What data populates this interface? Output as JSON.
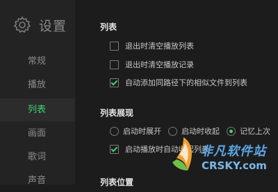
{
  "sidebar": {
    "title": "设置",
    "title_icon": "gear-icon",
    "items": [
      {
        "label": "常规"
      },
      {
        "label": "播放"
      },
      {
        "label": "列表"
      },
      {
        "label": "画面"
      },
      {
        "label": "歌词"
      },
      {
        "label": "声音"
      }
    ],
    "active_index": 2
  },
  "sections": {
    "list": {
      "title": "列表",
      "options": [
        {
          "label": "退出时清空播放列表",
          "checked": false
        },
        {
          "label": "退出时清空播放记录",
          "checked": false
        },
        {
          "label": "自动添加同路径下的相似文件到列表",
          "checked": true
        }
      ]
    },
    "list_display": {
      "title": "列表展现",
      "radios": [
        {
          "label": "启动时展开",
          "checked": false
        },
        {
          "label": "启动时收起",
          "checked": false
        },
        {
          "label": "记忆上次",
          "checked": true
        }
      ],
      "options": [
        {
          "label": "启动播放时自动收起列表",
          "checked": true
        }
      ]
    },
    "list_position": {
      "title": "列表位置"
    }
  },
  "watermark": {
    "cn": "非凡软件站",
    "en": "CRSKY.com"
  },
  "colors": {
    "accent": "#3fd175",
    "sidebar_bg": "#232323",
    "main_bg": "#1c1c1c"
  }
}
